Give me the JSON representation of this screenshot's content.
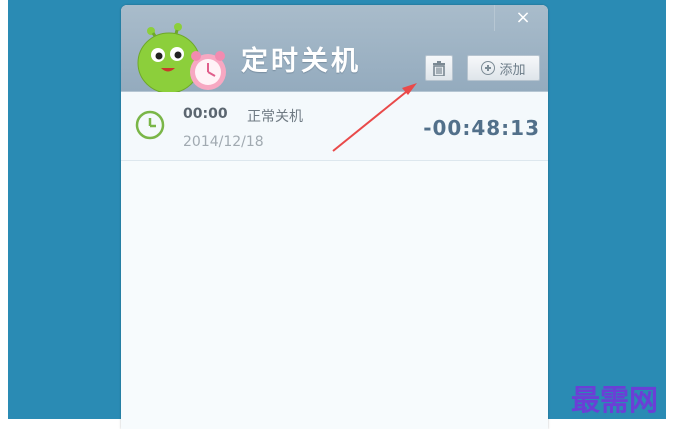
{
  "window": {
    "title": "定时关机",
    "close_symbol": "×",
    "toolbar": {
      "delete_icon": "trash-icon",
      "add_label": "添加"
    }
  },
  "task": {
    "time": "00:00",
    "action": "正常关机",
    "date": "2014/12/18",
    "countdown": "-00:48:13"
  },
  "watermark": "最需网",
  "colors": {
    "desktop": "#2a8bb4",
    "title_bar": "#9fb3c4",
    "clock_green": "#7ab648",
    "arrow_red": "#e94a4a",
    "watermark_purple": "#6b3fd6"
  }
}
